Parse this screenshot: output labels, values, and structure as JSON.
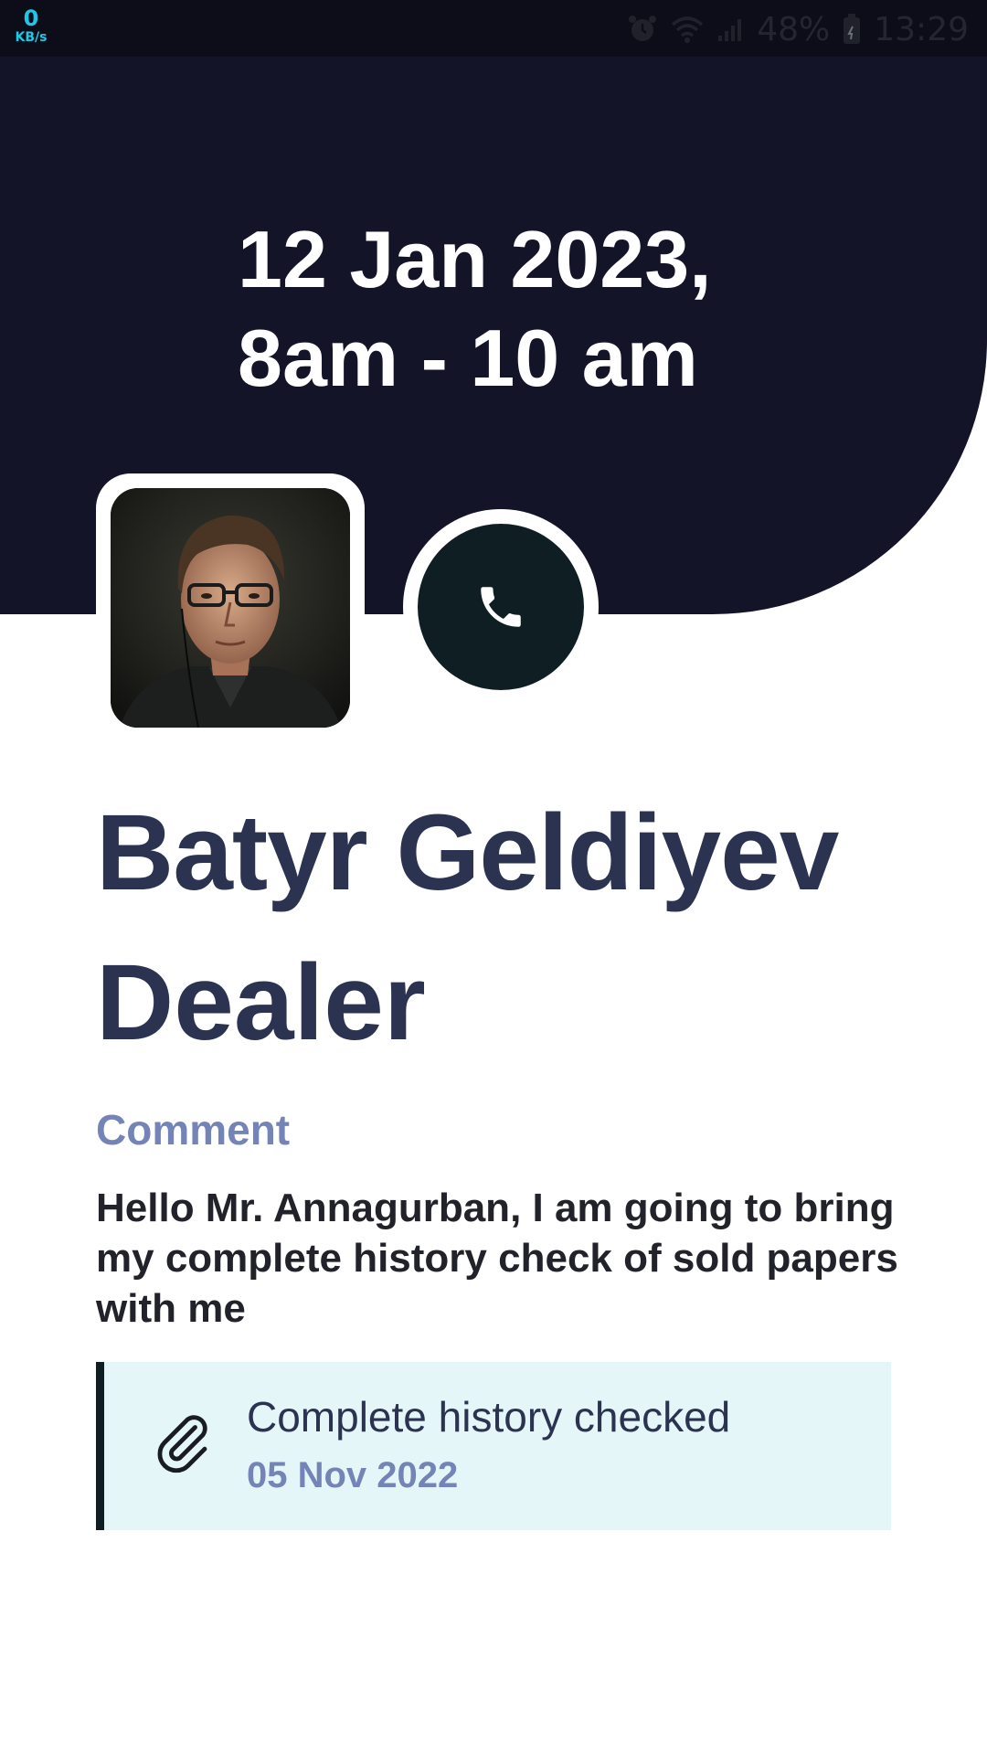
{
  "status_bar": {
    "net_speed_value": "0",
    "net_speed_unit": "KB/s",
    "battery": "48%",
    "time": "13:29",
    "icons": [
      "alarm-icon",
      "wifi-icon",
      "signal-icon",
      "battery-icon"
    ]
  },
  "appointment": {
    "date": "12 Jan 2023,",
    "time_range": "8am - 10 am"
  },
  "contact": {
    "name": "Batyr Geldiyev",
    "role": "Dealer",
    "avatar_icon": "avatar-photo",
    "call_icon": "phone-icon"
  },
  "comment": {
    "label": "Comment",
    "text": "Hello Mr. Annagurban, I am going to bring my complete history check of sold papers with me"
  },
  "attachment": {
    "icon": "paperclip-icon",
    "title": "Complete history checked",
    "date": "05 Nov 2022"
  },
  "colors": {
    "header_bg": "#141428",
    "accent_dark": "#0f1e23",
    "name_text": "#2b3350",
    "label_text": "#7584b6",
    "attachment_bg": "#e5f6f9",
    "net_speed": "#1ec8e6"
  }
}
